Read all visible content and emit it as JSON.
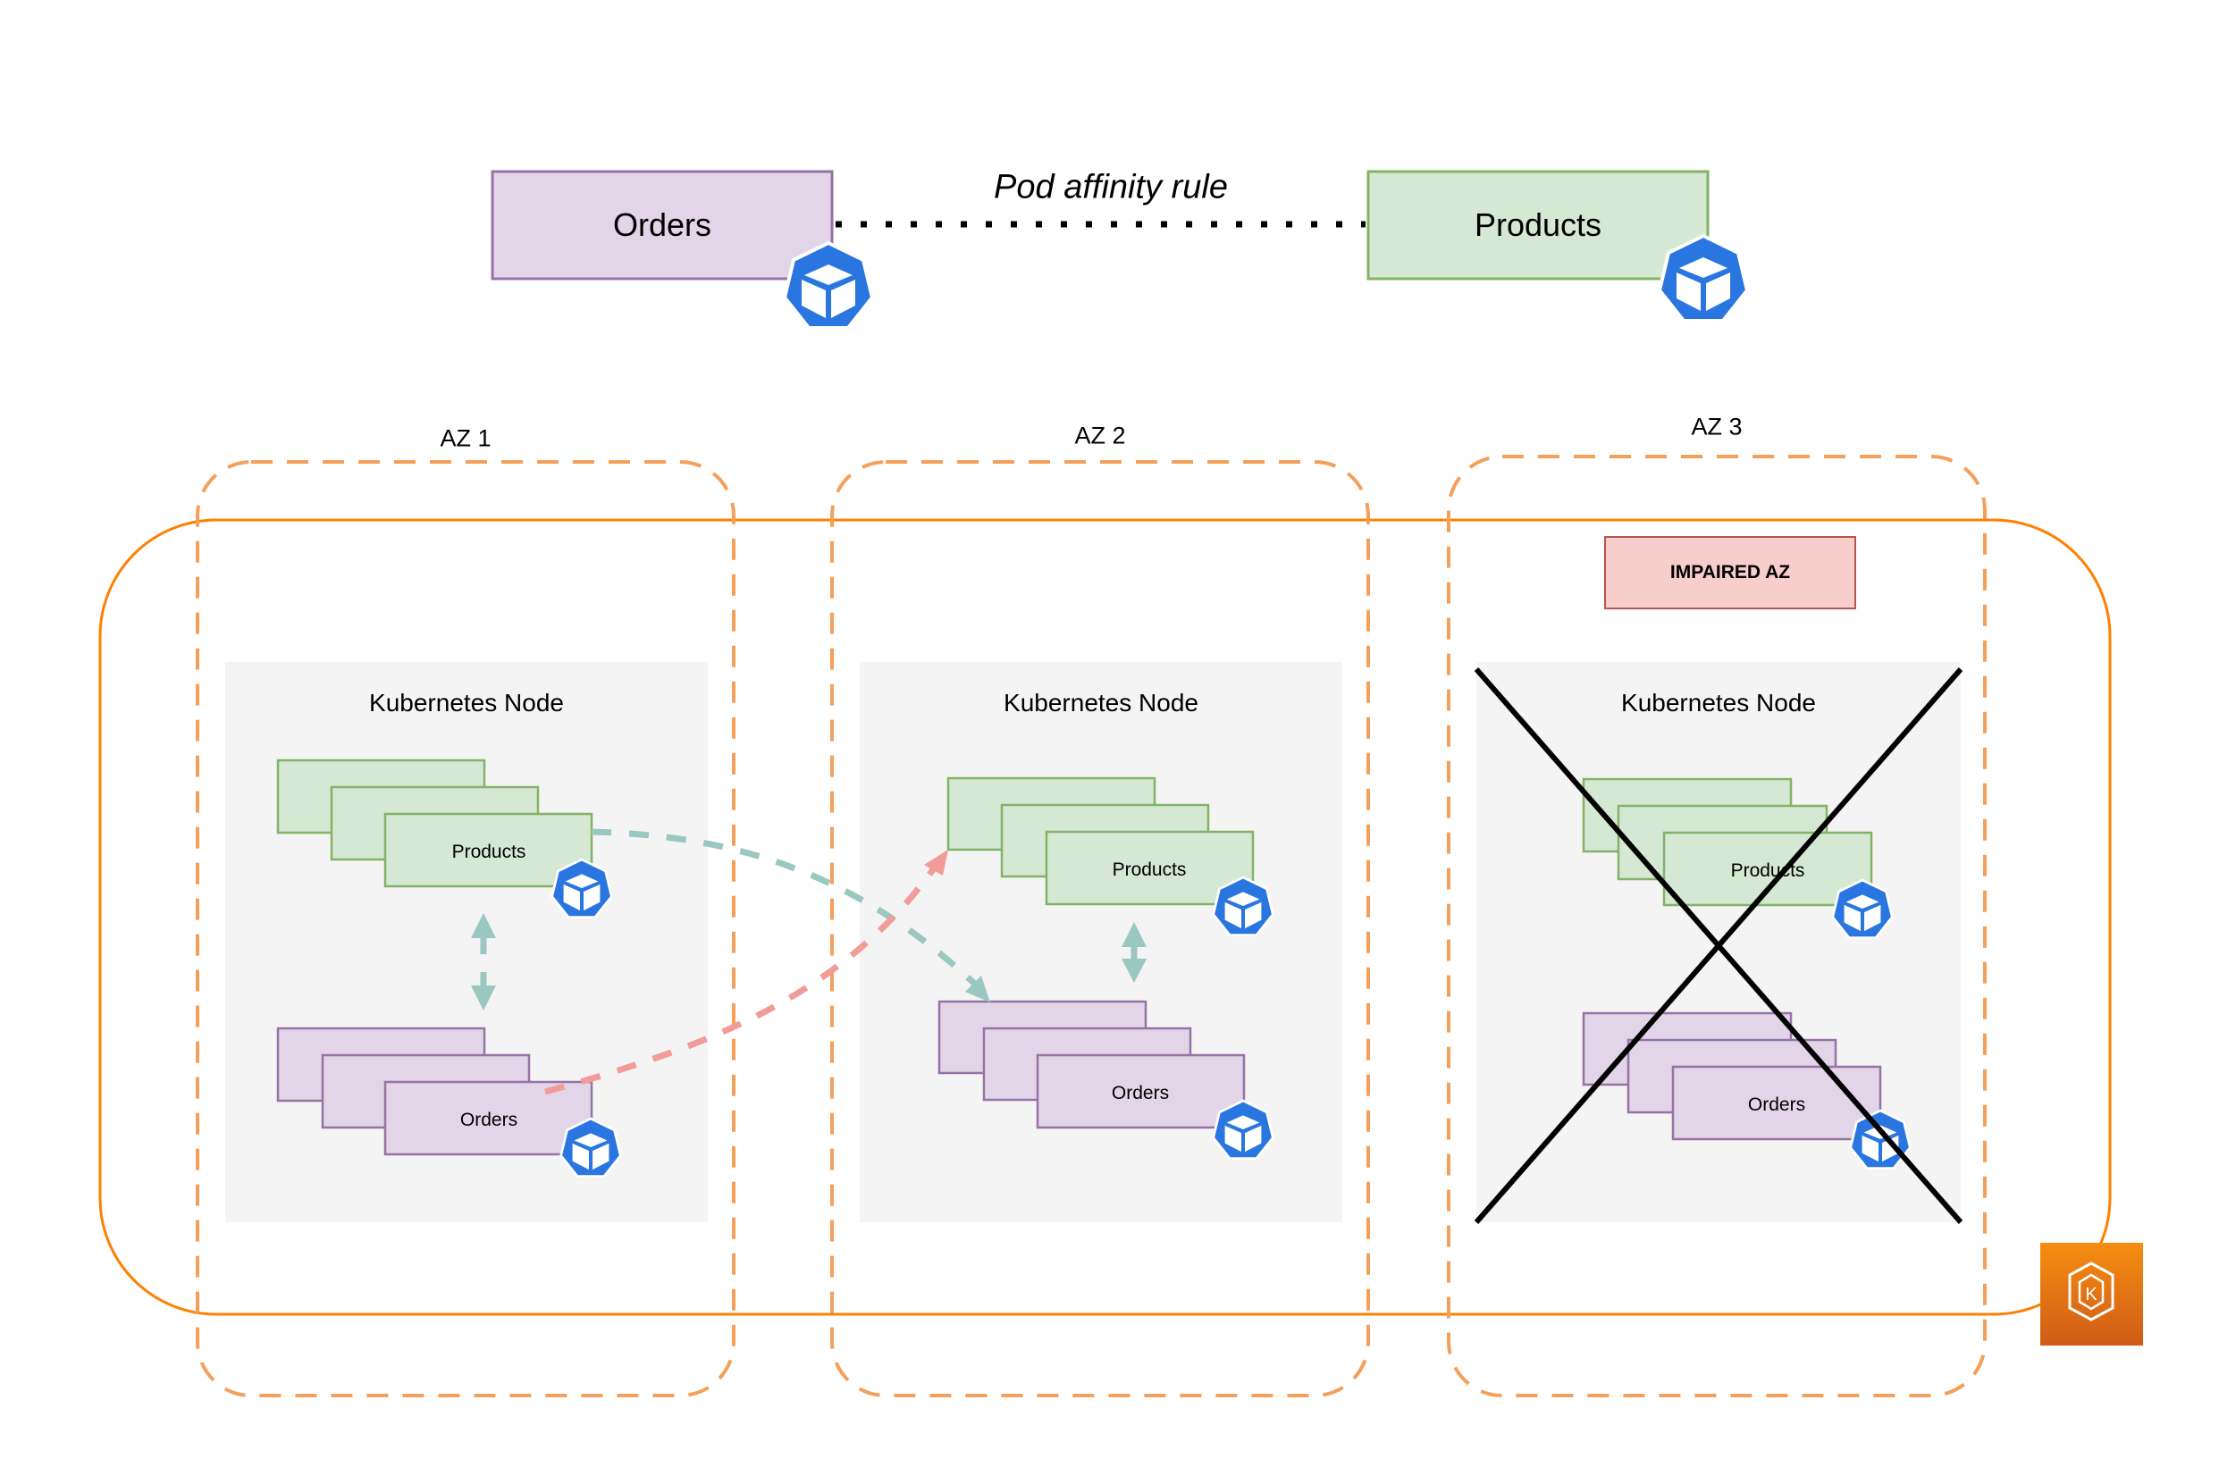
{
  "legend": {
    "title": "Pod affinity rule",
    "orders": {
      "label": "Orders"
    },
    "products": {
      "label": "Products"
    }
  },
  "zones": [
    {
      "label": "AZ 1",
      "node_label": "Kubernetes Node",
      "products_label": "Products",
      "orders_label": "Orders",
      "impaired": false
    },
    {
      "label": "AZ 2",
      "node_label": "Kubernetes Node",
      "products_label": "Products",
      "orders_label": "Orders",
      "impaired": false
    },
    {
      "label": "AZ 3",
      "node_label": "Kubernetes Node",
      "products_label": "Products",
      "orders_label": "Orders",
      "impaired": true,
      "status_badge": "IMPAIRED AZ"
    }
  ],
  "icons": {
    "pod": "kubernetes-pod-icon",
    "cluster": "amazon-eks-icon"
  },
  "colors": {
    "orders_fill": "#e1d5e7",
    "orders_stroke": "#9673a6",
    "products_fill": "#d5e8d4",
    "products_stroke": "#82b366",
    "az_dashed": "#f5a05a",
    "cluster_border": "#ff8000",
    "node_bg": "#f4f4f4",
    "pod_icon": "#2a76e0",
    "affinity_arrow": "#9ac7bf",
    "failover_arrow": "#f19c99",
    "impaired_fill": "#f8cecc",
    "impaired_stroke": "#b85450",
    "eks_top": "#f68d11",
    "eks_bottom": "#d05c17"
  }
}
